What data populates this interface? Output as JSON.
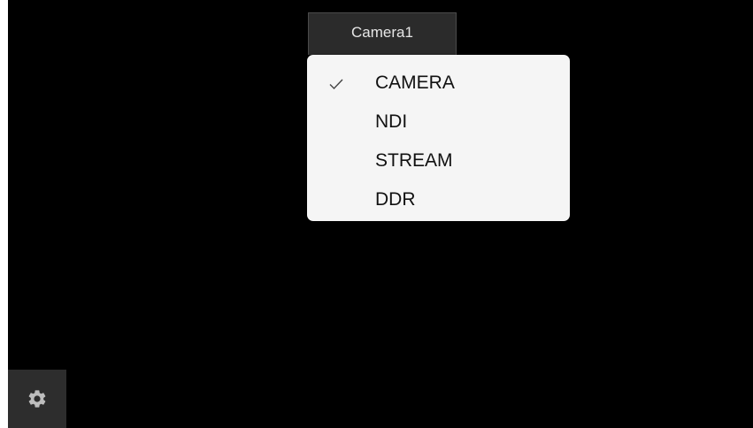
{
  "camera_tab": {
    "label": "Camera1"
  },
  "source_menu": {
    "items": [
      {
        "label": "CAMERA",
        "checked": true
      },
      {
        "label": "NDI",
        "checked": false
      },
      {
        "label": "STREAM",
        "checked": false
      },
      {
        "label": "DDR",
        "checked": false
      }
    ],
    "check_icon": "checkmark-icon"
  },
  "settings": {
    "icon": "gear-icon"
  },
  "colors": {
    "viewport_background": "#000000",
    "tab_background": "#2b2b2b",
    "menu_background": "#f5f5f5",
    "settings_background": "#2d2d2d",
    "gear_color": "#bdbdbd"
  }
}
